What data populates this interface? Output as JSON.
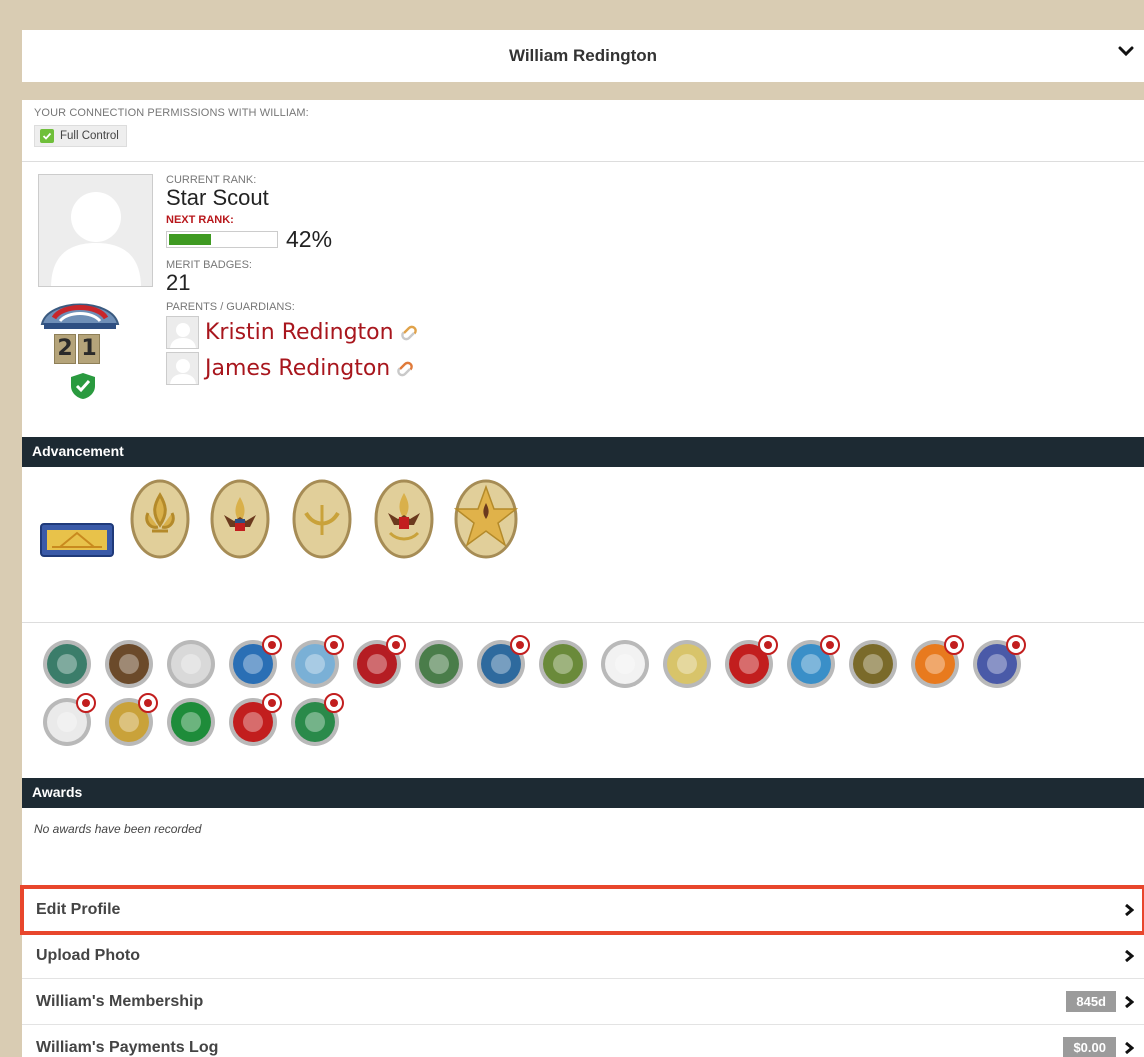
{
  "header": {
    "title": "William Redington",
    "chevron_icon": "chevron-down-icon"
  },
  "permissions": {
    "label": "YOUR CONNECTION PERMISSIONS WITH WILLIAM:",
    "badge": "Full Control"
  },
  "profile": {
    "current_rank_label": "CURRENT RANK:",
    "current_rank": "Star Scout",
    "next_rank_label": "NEXT RANK:",
    "next_rank_progress": "42%",
    "next_rank_fraction": 0.42,
    "merit_badges_label": "MERIT BADGES:",
    "merit_badges_count": "21",
    "unit_number": [
      "2",
      "1"
    ],
    "parents_label": "PARENTS / GUARDIANS:",
    "parents": [
      "Kristin Redington",
      "James Redington"
    ]
  },
  "advancement": {
    "heading": "Advancement",
    "rank_patches": [
      "arrow-of-light",
      "scout",
      "tenderfoot",
      "second-class",
      "first-class",
      "star"
    ],
    "merit_badge_colors": [
      "#3b7d6a",
      "#6b4a2a",
      "#d9d9d9",
      "#2a6fb5",
      "#7ab0d6",
      "#b51d23",
      "#4a7d4a",
      "#2e6a9e",
      "#6a8a3a",
      "#f2f2f2",
      "#d8c46a",
      "#c21e1e",
      "#3a8fc8",
      "#7a6a2a",
      "#e87a1e",
      "#4a5aa8",
      "#eaeaea",
      "#c9a23a",
      "#1e8c3a",
      "#c21e1e",
      "#2a8a4a"
    ]
  },
  "awards": {
    "heading": "Awards",
    "empty_text": "No awards have been recorded"
  },
  "menu": [
    {
      "label": "Edit Profile",
      "badge": "",
      "highlight": true
    },
    {
      "label": "Upload Photo",
      "badge": ""
    },
    {
      "label": "William's Membership",
      "badge": "845d"
    },
    {
      "label": "William's Payments Log",
      "badge": "$0.00"
    }
  ],
  "colors": {
    "accent_red": "#a8161d",
    "section_bar": "#1d2a33",
    "progress_green": "#3f9a22",
    "highlight": "#e8462c"
  }
}
